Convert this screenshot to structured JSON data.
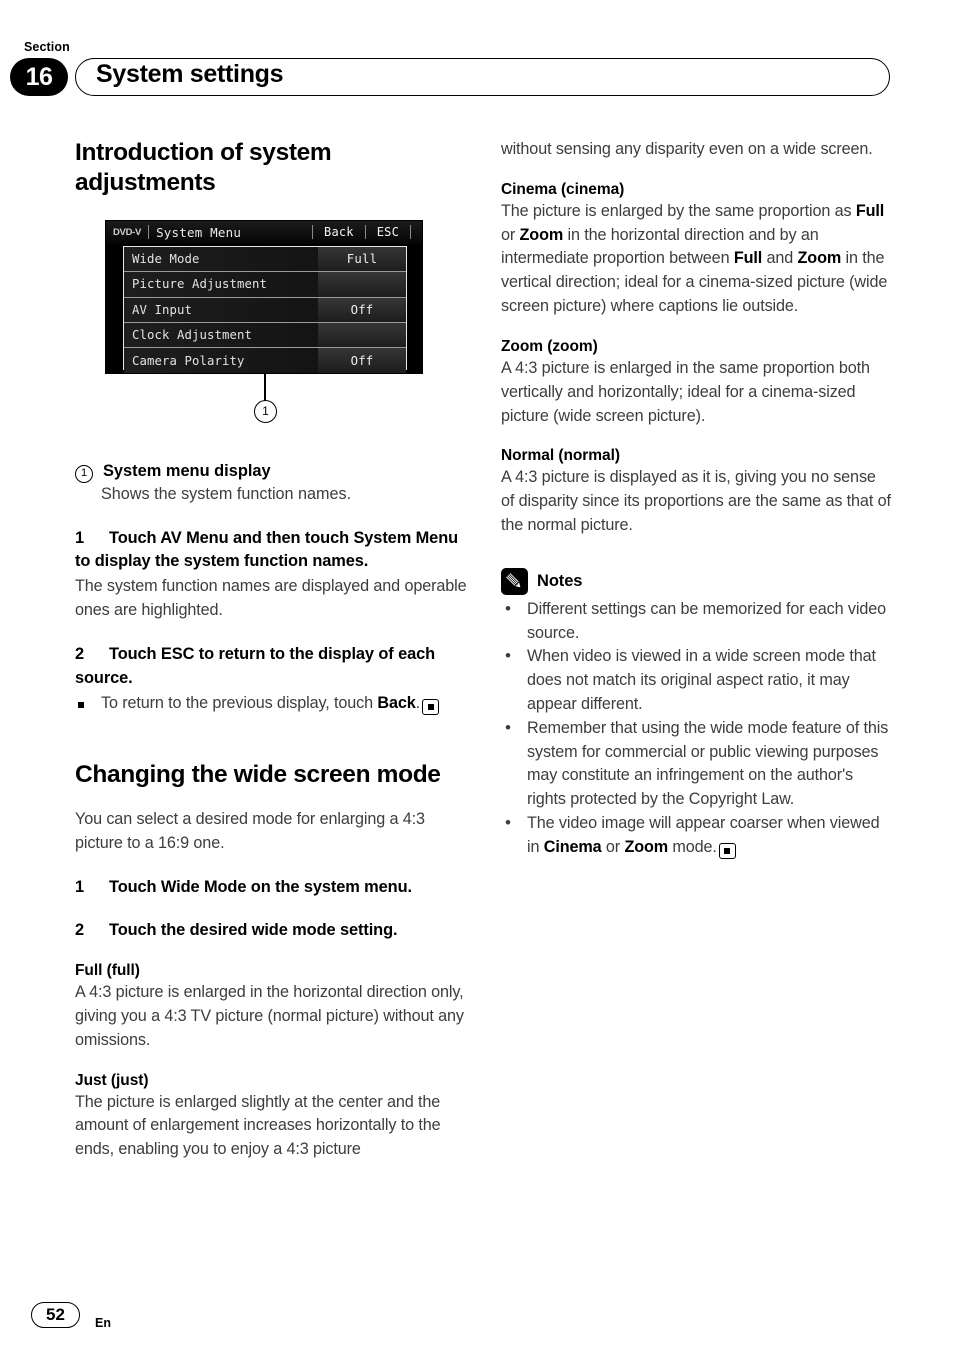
{
  "header": {
    "section_word": "Section",
    "section_number": "16",
    "section_title": "System settings"
  },
  "left_column": {
    "heading_1": "Introduction of system adjustments",
    "figure": {
      "source_label": "DVD-V",
      "menu_title": "System Menu",
      "button_back": "Back",
      "button_esc": "ESC",
      "rows": [
        {
          "name": "Wide Mode",
          "value": "Full"
        },
        {
          "name": "Picture Adjustment",
          "value": ""
        },
        {
          "name": "AV Input",
          "value": "Off"
        },
        {
          "name": "Clock Adjustment",
          "value": ""
        },
        {
          "name": "Camera Polarity",
          "value": "Off"
        }
      ],
      "callout_number": "1"
    },
    "callout": {
      "marker": "1",
      "title": "System menu display",
      "description": "Shows the system function names."
    },
    "step_1": {
      "num": "1",
      "text": "Touch AV Menu and then touch System Menu to display the system function names.",
      "body": "The system function names are displayed and operable ones are highlighted."
    },
    "step_2": {
      "num": "2",
      "text": "Touch ESC to return to the display of each source.",
      "bullet_pre": "To return to the previous display, touch ",
      "bullet_bold": "Back",
      "bullet_post": "."
    },
    "heading_2": "Changing the wide screen mode",
    "heading_2_body": "You can select a desired mode for enlarging a 4:3 picture to a 16:9 one.",
    "wide_step_1": {
      "num": "1",
      "text": "Touch Wide Mode on the system menu."
    },
    "wide_step_2": {
      "num": "2",
      "text": "Touch the desired wide mode setting."
    },
    "mode_full": {
      "title": "Full (full)",
      "body": "A 4:3 picture is enlarged in the horizontal direction only, giving you a 4:3 TV picture (normal picture) without any omissions."
    },
    "mode_just": {
      "title": "Just (just)",
      "body": "The picture is enlarged slightly at the center and the amount of enlargement increases horizontally to the ends, enabling you to enjoy a 4:3 picture"
    }
  },
  "right_column": {
    "continuation": "without sensing any disparity even on a wide screen.",
    "mode_cinema": {
      "title": "Cinema (cinema)",
      "part1": "The picture is enlarged by the same proportion as ",
      "bold1": "Full",
      "part2": " or ",
      "bold2": "Zoom",
      "part3": " in the horizontal direction and by an intermediate proportion between ",
      "bold3": "Full",
      "part4": " and ",
      "bold4": "Zoom",
      "part5": " in the vertical direction; ideal for a cinema-sized picture (wide screen picture) where captions lie outside."
    },
    "mode_zoom": {
      "title": "Zoom (zoom)",
      "body": "A 4:3 picture is enlarged in the same proportion both vertically and horizontally; ideal for a cinema-sized picture (wide screen picture)."
    },
    "mode_normal": {
      "title": "Normal (normal)",
      "body": "A 4:3 picture is displayed as it is, giving you no sense of disparity since its proportions are the same as that of the normal picture."
    },
    "notes": {
      "icon": "pencil-icon",
      "label": "Notes",
      "items": [
        {
          "text": "Different settings can be memorized for each video source."
        },
        {
          "text": "When video is viewed in a wide screen mode that does not match its original aspect ratio, it may appear different."
        },
        {
          "text": "Remember that using the wide mode feature of this system for commercial or public viewing purposes may constitute an infringement on the author's rights protected by the Copyright Law."
        },
        {
          "pre": "The video image will appear coarser when viewed in ",
          "bold1": "Cinema",
          "mid": " or ",
          "bold2": "Zoom",
          "post": " mode.",
          "end_marker": true
        }
      ]
    }
  },
  "footer": {
    "page_number": "52",
    "language": "En"
  }
}
